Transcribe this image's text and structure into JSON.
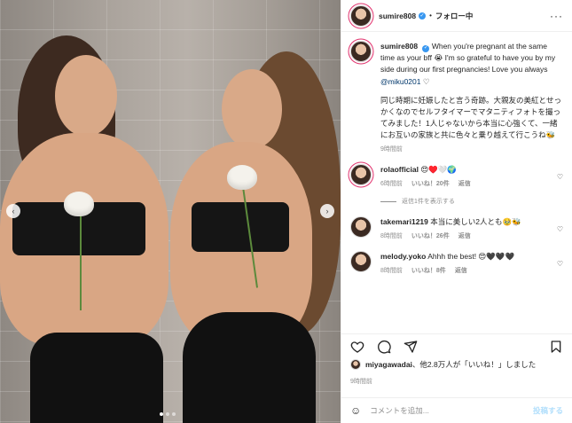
{
  "post": {
    "author": "sumire808",
    "follow_label": "フォロー中",
    "caption": "When you're pregnant at the same time as your bff 😭 I'm so grateful to have you by my side during our first pregnancies! Love you always",
    "caption_mention": "@miku0201",
    "caption_end": "♡",
    "caption_jp": "同じ時期に妊娠したと言う奇跡。大親友の美紅とせっかくなのでセルフタイマーでマタニティフォトを撮ってみました！1人じゃないから本当に心強くて、一緒にお互いの家族と共に色々と乗り越えて行こうね🐝",
    "caption_time": "9時間前"
  },
  "comments": [
    {
      "user": "rolaofficial",
      "text": "😍♥️🤍🌍",
      "time": "6時間前",
      "likes": "いいね！20件",
      "reply": "返信",
      "has_likes": true
    },
    {
      "user": "takemari1219",
      "text": "本当に美しい2人とも🥹🐝",
      "time": "8時間前",
      "likes": "いいね！26件",
      "reply": "返信",
      "has_likes": true
    },
    {
      "user": "melody.yoko",
      "text": "Ahhh the best! 😍🖤🖤🖤",
      "time": "8時間前",
      "likes": "いいね！8件",
      "reply": "返信",
      "has_likes": true
    }
  ],
  "replies_label": "返信1件を表示する",
  "likes_line": {
    "user": "miyagawadai",
    "rest": "、他2.8万人が「いいね！」しました"
  },
  "post_time": "9時間前",
  "add_comment": {
    "placeholder": "コメントを追加...",
    "post_label": "投稿する"
  },
  "colors": {
    "link": "#00376b",
    "verified": "#3897f0",
    "muted": "#8e8e8e"
  },
  "icons": [
    "heart-icon",
    "comment-icon",
    "share-icon",
    "bookmark-icon",
    "emoji-icon",
    "more-icon",
    "verified-icon"
  ]
}
